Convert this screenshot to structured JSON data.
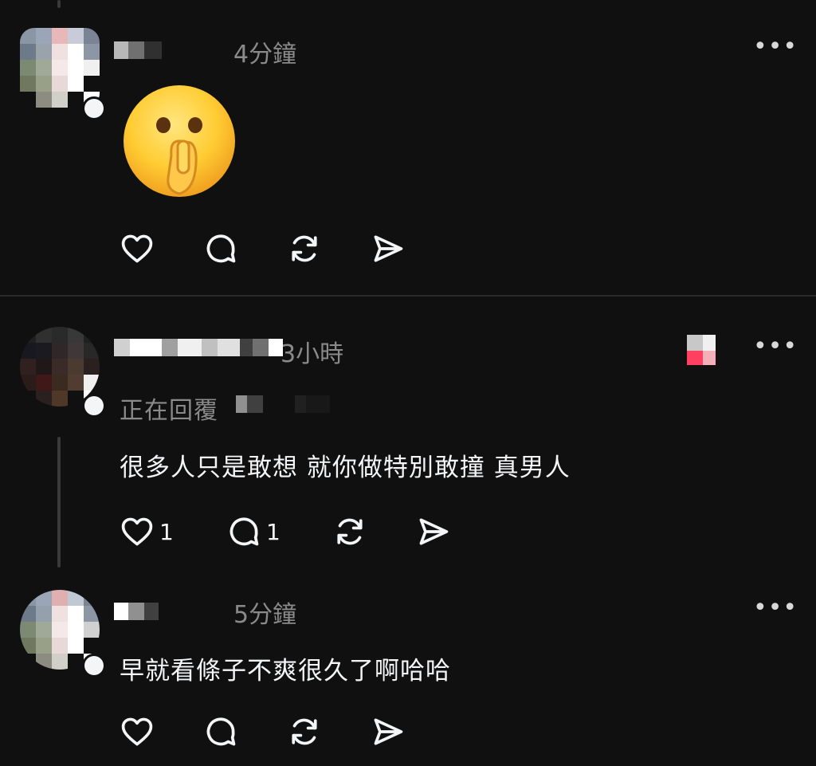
{
  "posts": [
    {
      "time": "4分鐘",
      "more_label": "•••",
      "content_emoji": "shushing-face",
      "actions": [
        {
          "icon": "heart-icon",
          "count": ""
        },
        {
          "icon": "comment-icon",
          "count": ""
        },
        {
          "icon": "repost-icon",
          "count": ""
        },
        {
          "icon": "share-icon",
          "count": ""
        }
      ]
    },
    {
      "time": "3小時",
      "more_label": "•••",
      "reply_label": "正在回覆",
      "text": "很多人只是敢想 就你做特別敢撞 真男人",
      "actions": [
        {
          "icon": "heart-icon",
          "count": "1"
        },
        {
          "icon": "comment-icon",
          "count": "1"
        },
        {
          "icon": "repost-icon",
          "count": ""
        },
        {
          "icon": "share-icon",
          "count": ""
        }
      ]
    },
    {
      "time": "5分鐘",
      "more_label": "•••",
      "text": "早就看條子不爽很久了啊哈哈",
      "actions": [
        {
          "icon": "heart-icon",
          "count": ""
        },
        {
          "icon": "comment-icon",
          "count": ""
        },
        {
          "icon": "repost-icon",
          "count": ""
        },
        {
          "icon": "share-icon",
          "count": ""
        }
      ]
    }
  ],
  "colors": {
    "background": "#101010",
    "text": "#f3f5f7",
    "muted": "#8a8a8a",
    "divider": "#2a2a2a",
    "emoji_yellow": "#ffcc33"
  }
}
